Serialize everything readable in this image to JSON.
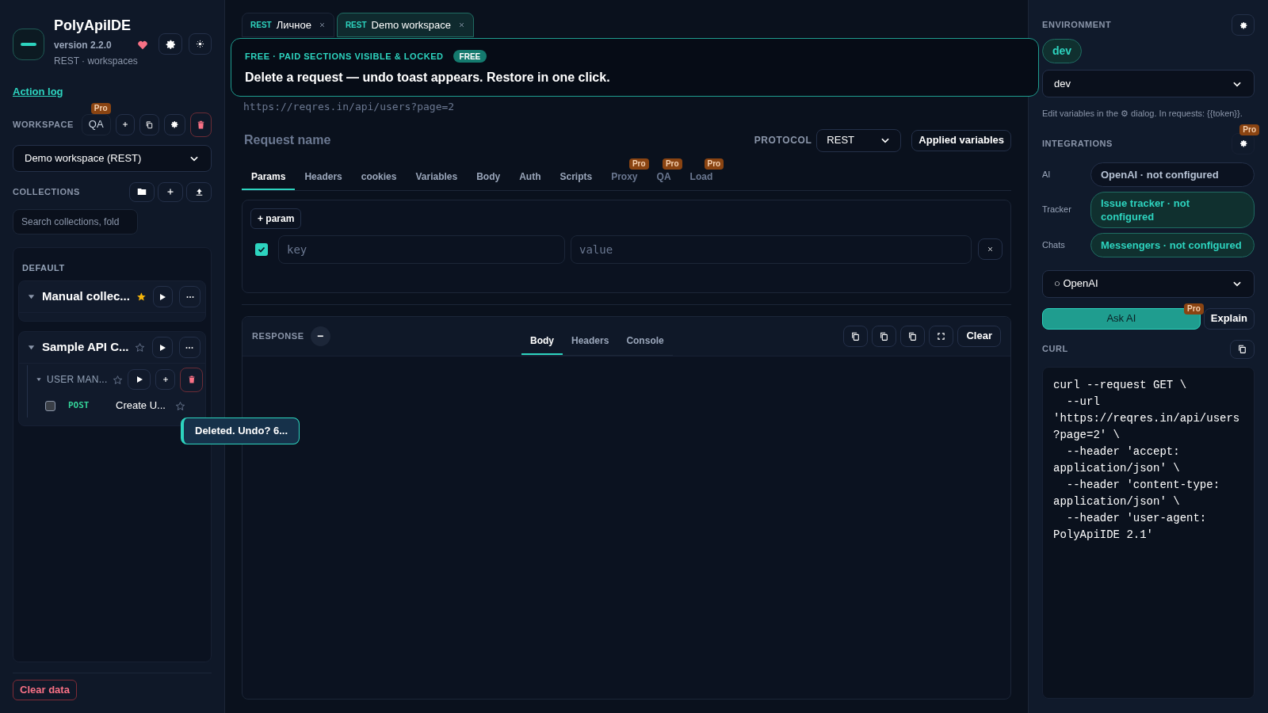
{
  "app": {
    "name": "PolyApiIDE",
    "version": "version 2.2.0",
    "subtitle": "REST · workspaces",
    "liked": true
  },
  "action_log": "Action log",
  "workspace": {
    "label": "WORKSPACE",
    "qa_label": "QA",
    "qa_badge": "Pro",
    "selected": "Demo workspace (REST)"
  },
  "collections": {
    "label": "COLLECTIONS",
    "search_placeholder": "Search collections, fold",
    "group": "DEFAULT",
    "items": [
      {
        "name": "Manual collec...",
        "starred": true,
        "expanded": true
      },
      {
        "name": "Sample API C...",
        "starred": false,
        "expanded": true,
        "children": [
          {
            "name": "USER MAN...",
            "starred": false,
            "expanded": true,
            "children": [
              {
                "method": "POST",
                "name": "Create U...",
                "checked": false,
                "starred": false
              }
            ]
          }
        ]
      }
    ]
  },
  "clear_data": "Clear data",
  "workspace_tabs": [
    {
      "protocol": "REST",
      "label": "Личное",
      "selected": false
    },
    {
      "protocol": "REST",
      "label": "Demo workspace",
      "selected": true
    }
  ],
  "banner": {
    "title": "FREE · PAID SECTIONS VISIBLE & LOCKED",
    "badge": "FREE",
    "message": "Delete a request — undo toast appears. Restore in one click."
  },
  "url": "https://reqres.in/api/users?page=2",
  "request": {
    "name_placeholder": "Request name",
    "protocol_label": "PROTOCOL",
    "protocol": "REST",
    "applied_variables": "Applied variables",
    "tabs": [
      {
        "label": "Params",
        "selected": true,
        "locked": false
      },
      {
        "label": "Headers",
        "selected": false,
        "locked": false
      },
      {
        "label": "cookies",
        "selected": false,
        "locked": false
      },
      {
        "label": "Variables",
        "selected": false,
        "locked": false
      },
      {
        "label": "Body",
        "selected": false,
        "locked": false
      },
      {
        "label": "Auth",
        "selected": false,
        "locked": false
      },
      {
        "label": "Scripts",
        "selected": false,
        "locked": false
      },
      {
        "label": "Proxy",
        "selected": false,
        "locked": true,
        "badge": "Pro"
      },
      {
        "label": "QA",
        "selected": false,
        "locked": true,
        "badge": "Pro"
      },
      {
        "label": "Load",
        "selected": false,
        "locked": true,
        "badge": "Pro"
      }
    ]
  },
  "params": {
    "add": "+ param",
    "rows": [
      {
        "checked": true,
        "key_placeholder": "key",
        "value_placeholder": "value"
      }
    ]
  },
  "response": {
    "label": "RESPONSE",
    "collapse": "−",
    "clear": "Clear",
    "tabs": [
      {
        "label": "Body",
        "selected": true
      },
      {
        "label": "Headers",
        "selected": false
      },
      {
        "label": "Console",
        "selected": false
      }
    ]
  },
  "environment": {
    "label": "ENVIRONMENT",
    "active": "dev",
    "selected": "dev",
    "hint": "Edit variables in the ⚙ dialog. In requests: {{token}}."
  },
  "integrations": {
    "label": "INTEGRATIONS",
    "badge": "Pro",
    "items": [
      {
        "label": "AI",
        "value": "OpenAI · not configured",
        "kind": "neutral"
      },
      {
        "label": "Tracker",
        "value": "Issue tracker · not configured",
        "kind": "accent"
      },
      {
        "label": "Chats",
        "value": "Messengers · not configured",
        "kind": "accent"
      }
    ]
  },
  "ai": {
    "provider": "○ OpenAI",
    "ask": "Ask AI",
    "badge": "Pro",
    "explain": "Explain"
  },
  "curl": {
    "label": "CURL",
    "code": "curl --request GET \\\n  --url 'https://reqres.in/api/users?page=2' \\\n  --header 'accept: application/json' \\\n  --header 'content-type: application/json' \\\n  --header 'user-agent: PolyApiIDE 2.1'"
  },
  "toast": "Deleted. Undo? 6..."
}
